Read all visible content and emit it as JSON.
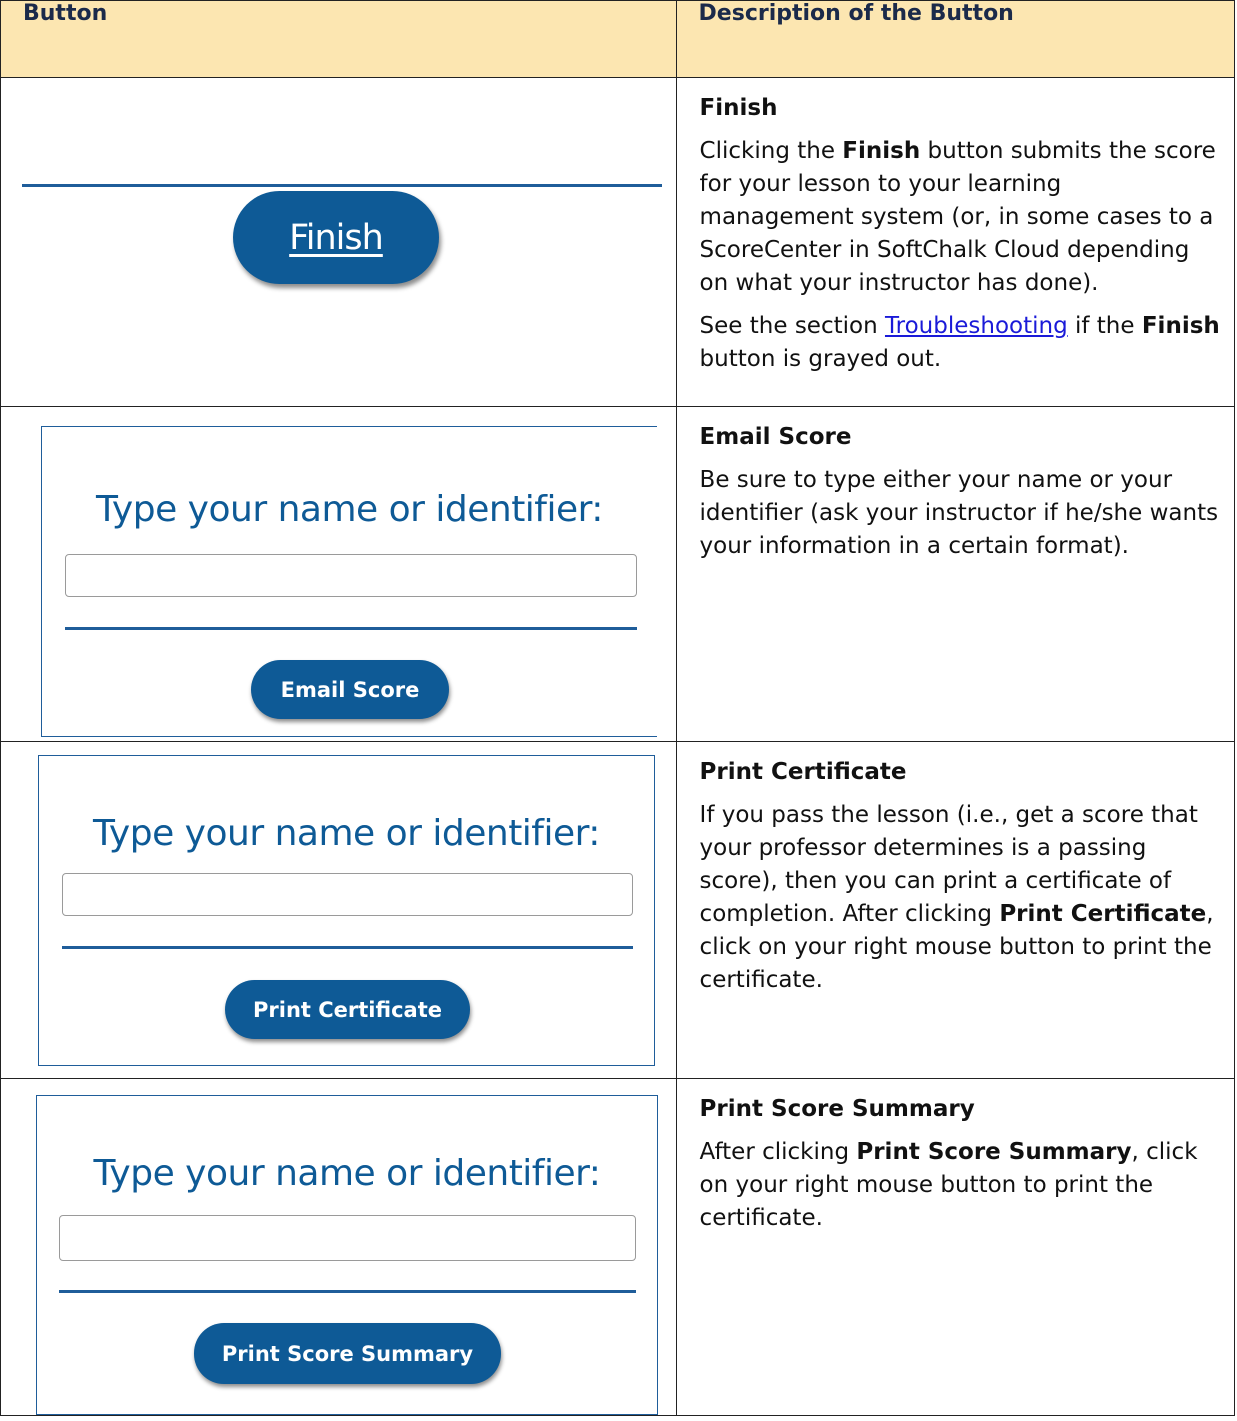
{
  "table": {
    "header": {
      "col1": "Button",
      "col2": "Description of the Button"
    }
  },
  "rows": {
    "finish": {
      "button_label": "Finish",
      "heading": "Finish",
      "p1_a": "Clicking the ",
      "p1_bold": "Finish",
      "p1_b": " button submits the score for your lesson to your learning management system (or, in some cases to a ScoreCenter in SoftChalk Cloud depending on what your instructor has done).",
      "p2_a": "See the section ",
      "p2_link": "Troubleshooting",
      "p2_b": " if the ",
      "p2_bold": "Finish",
      "p2_c": " button is grayed out."
    },
    "email": {
      "panel_title": "Type your name or identifier:",
      "button_label": "Email Score",
      "heading": "Email Score",
      "p1": "Be sure to type either your name or your identifier (ask your instructor if he/she wants your information in a certain format)."
    },
    "certificate": {
      "panel_title": "Type your name or identifier:",
      "button_label": "Print Certificate",
      "heading": "Print Certificate",
      "p1_a": "If you pass the lesson (i.e., get a score that your professor determines is a passing score), then you can print a certificate of completion. After clicking ",
      "p1_bold": "Print Certificate",
      "p1_b": ", click on your right mouse button to print the certificate."
    },
    "summary": {
      "panel_title": "Type your name or identifier:",
      "button_label": "Print Score Summary",
      "heading": "Print Score Summary",
      "p1_a": "After clicking ",
      "p1_bold": "Print Score Summary",
      "p1_b": ", click on your right mouse button to print the certificate."
    }
  },
  "colors": {
    "header_bg": "#fce6b1",
    "brand_blue": "#0e5a96",
    "link_blue": "#1a1ad8"
  }
}
